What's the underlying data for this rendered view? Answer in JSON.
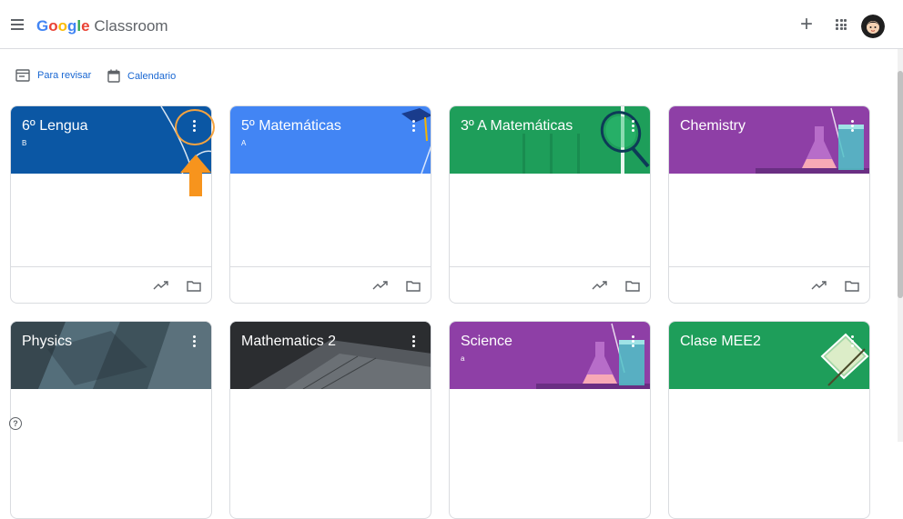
{
  "header": {
    "brand_google": "Google",
    "brand_product": "Classroom",
    "menu_icon": "hamburger-menu-icon",
    "plus_icon": "add-icon",
    "apps_icon": "apps-grid-icon",
    "avatar_icon": "user-avatar"
  },
  "subnav": {
    "items": [
      {
        "label": "Para revisar",
        "icon": "review-tray-icon"
      },
      {
        "label": "Calendario",
        "icon": "calendar-icon"
      }
    ]
  },
  "cards": [
    {
      "title": "6º Lengua",
      "section": "B",
      "color": "#0b57a4"
    },
    {
      "title": "5º Matemáticas",
      "section": "A",
      "color": "#4285f4"
    },
    {
      "title": "3º A Matemáticas",
      "section": "",
      "color": "#1e9e5a"
    },
    {
      "title": "Chemistry",
      "section": "",
      "color": "#8e3fa6"
    },
    {
      "title": "Physics",
      "section": "",
      "color": "#455a64"
    },
    {
      "title": "Mathematics 2",
      "section": "",
      "color": "#3c4043"
    },
    {
      "title": "Science",
      "section": "a",
      "color": "#8e3fa6"
    },
    {
      "title": "Clase MEE2",
      "section": "",
      "color": "#1e9e5a"
    }
  ],
  "colors": {
    "accent_blue": "#1967d2",
    "highlight_orange": "#f4a340"
  }
}
